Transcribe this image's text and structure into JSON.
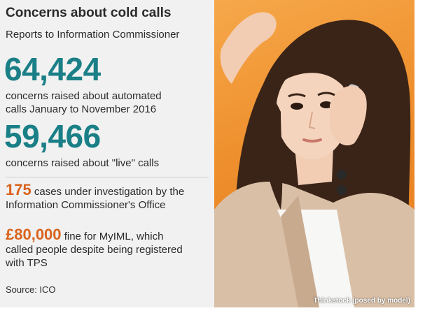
{
  "header": {
    "title": "Concerns about cold calls",
    "subtitle": "Reports to Information Commissioner"
  },
  "stats": {
    "automated": {
      "number": "64,424",
      "line1": "concerns raised about automated",
      "line2": "calls January to November 2016"
    },
    "live": {
      "number": "59,466",
      "text": "concerns raised about \"live\" calls"
    },
    "investigations": {
      "number": "175",
      "line1": " cases under investigation by the",
      "line2": "Information Commissioner's Office"
    },
    "fine": {
      "number": "£80,000",
      "line1": " fine for MyIML, which",
      "line2": "called people despite being registered",
      "line3": "with TPS"
    }
  },
  "source": "Source: ICO",
  "photo": {
    "credit": "Thinkstock (posed by model)",
    "description_icon": "woman-on-phone-photo"
  },
  "colors": {
    "teal": "#1a7f86",
    "orange": "#d9631c",
    "panel": "#f1f1f1",
    "photo_bg": "#ee8e2c"
  }
}
